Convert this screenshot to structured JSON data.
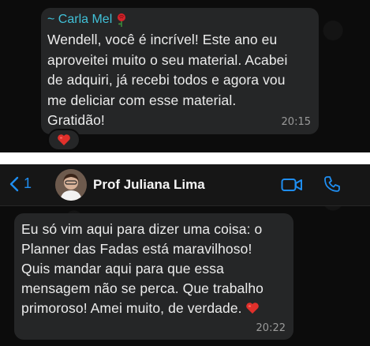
{
  "top_chat": {
    "sender_name": "~ Carla Mel",
    "sender_emoji": "rose-icon",
    "message": "Wendell, você é incrível! Este ano eu\naproveitei muito o seu material. Acabei\nde adquiri, já recebi todos e agora vou\nme deliciar com esse material.\nGratidão!",
    "time": "20:15",
    "reaction": "heart-icon"
  },
  "bottom_chat": {
    "header": {
      "back_count": "1",
      "contact_name": "Prof Juliana Lima"
    },
    "message": "Eu só vim aqui para dizer uma coisa: o\nPlanner das Fadas está maravilhoso!\nQuis mandar aqui para que essa\nmensagem não se perca. Que trabalho\nprimoroso! Amei muito, de verdade.",
    "message_emoji": "heart-icon",
    "time": "20:22"
  },
  "colors": {
    "chat_background": "#0b0b0b",
    "bubble": "#252627",
    "sender_name": "#41c0d7",
    "link_blue": "#1f8ef1",
    "heart_red": "#e0302b"
  }
}
